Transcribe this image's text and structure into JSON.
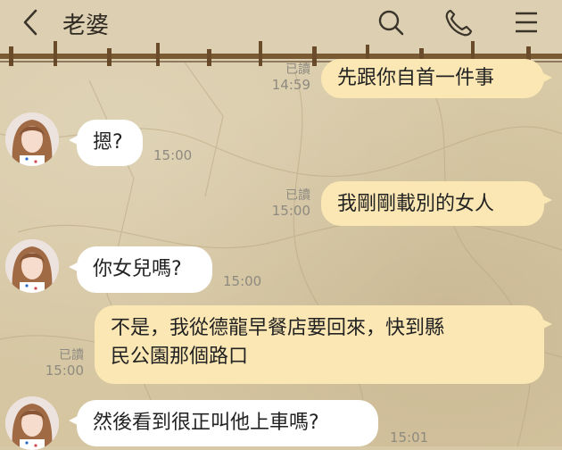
{
  "header": {
    "contact_name": "老婆",
    "icons": [
      "back-icon",
      "search-icon",
      "phone-icon",
      "menu-icon"
    ]
  },
  "messages": [
    {
      "side": "out",
      "text": "先跟你自首一件事",
      "read": "已讀",
      "time": "14:59"
    },
    {
      "side": "in",
      "text": "摁?",
      "time": "15:00"
    },
    {
      "side": "out",
      "text": "我剛剛載別的女人",
      "read": "已讀",
      "time": "15:00"
    },
    {
      "side": "in",
      "text": "你女兒嗎?",
      "time": "15:00"
    },
    {
      "side": "out",
      "text_line1": "不是，我從德龍早餐店要回來，快到縣",
      "text_line2": "民公園那個路口",
      "read": "已讀",
      "time": "15:00"
    },
    {
      "side": "in",
      "text": "然後看到很正叫他上車嗎?",
      "time": "15:01"
    }
  ],
  "colors": {
    "incoming_bubble": "#ffffff",
    "outgoing_bubble": "#fbe7b4",
    "header_bg": "#ddcfb1"
  }
}
